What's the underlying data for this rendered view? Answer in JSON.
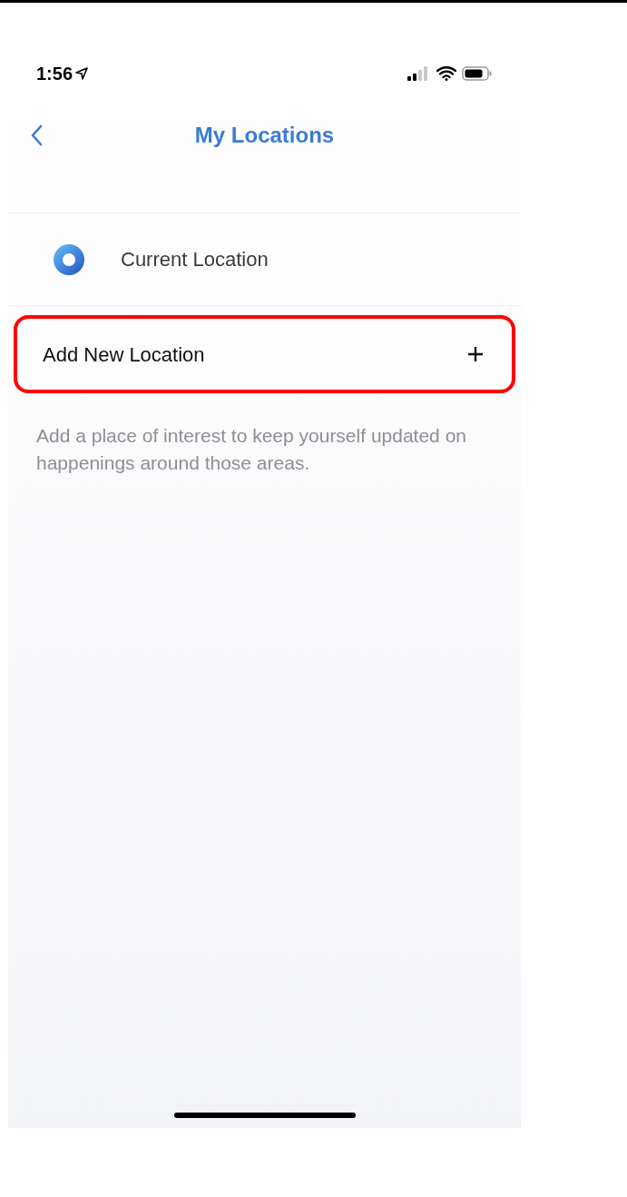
{
  "status_bar": {
    "time": "1:56"
  },
  "nav": {
    "title": "My Locations"
  },
  "locations": [
    {
      "kind": "current",
      "label": "Current Location",
      "highlighted": false
    },
    {
      "kind": "add",
      "label": "Add New Location",
      "highlighted": true
    }
  ],
  "hint": "Add a place of interest to keep yourself updated on happenings around those areas."
}
